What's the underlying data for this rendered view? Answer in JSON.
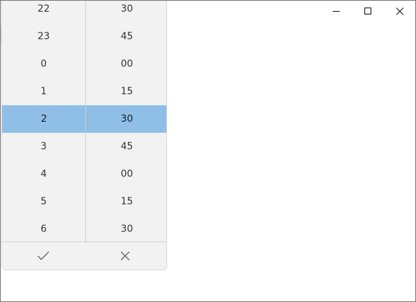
{
  "window": {
    "caption": {
      "minimize_icon": "minimize-icon",
      "maximize_icon": "maximize-icon",
      "close_icon": "close-icon"
    }
  },
  "time_picker": {
    "hours": [
      "22",
      "23",
      "0",
      "1",
      "2",
      "3",
      "4",
      "5",
      "6"
    ],
    "minutes": [
      "30",
      "45",
      "00",
      "15",
      "30",
      "45",
      "00",
      "15",
      "30"
    ],
    "selected_hour": "2",
    "selected_minute": "30",
    "selected_index": 4,
    "accept_icon": "checkmark-icon",
    "dismiss_icon": "close-icon",
    "selection_color": "#8fbfe6"
  }
}
